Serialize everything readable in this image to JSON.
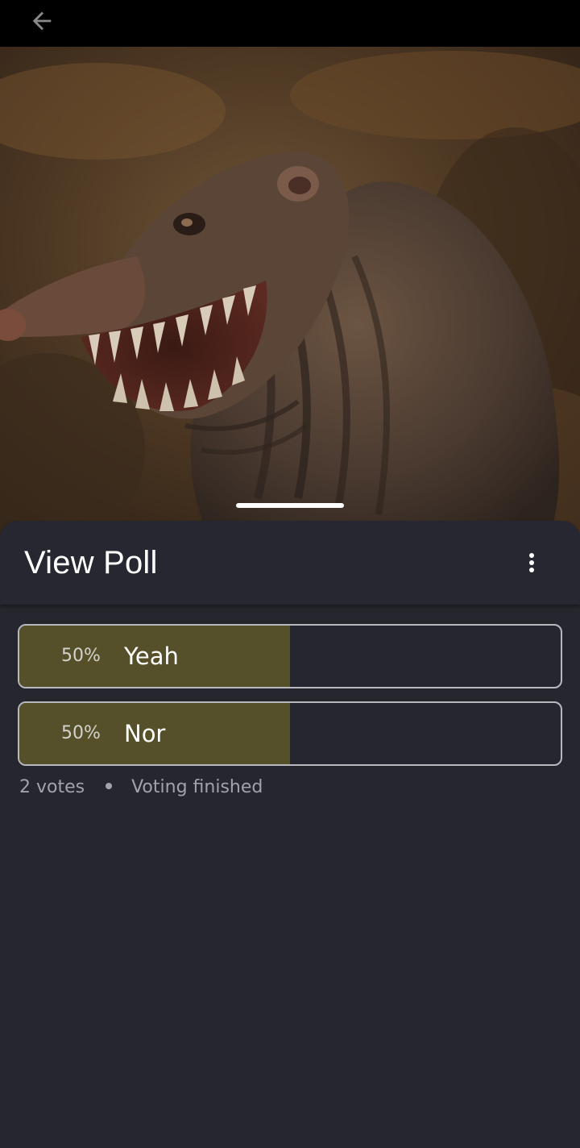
{
  "header": {
    "back_icon": "arrow-left-icon"
  },
  "media": {
    "description": "dark painted creature artwork"
  },
  "poll": {
    "title": "View Poll",
    "menu_icon": "more-vertical-icon",
    "options": [
      {
        "percent_label": "50%",
        "label": "Yeah",
        "share": 0.5
      },
      {
        "percent_label": "50%",
        "label": "Nor",
        "share": 0.5
      }
    ],
    "votes": "2 votes",
    "status": "Voting finished"
  },
  "colors": {
    "sheet_bg": "#26262f",
    "fill": "#555029",
    "border": "#b8b8bf",
    "meta_text": "#a2a2ab"
  }
}
